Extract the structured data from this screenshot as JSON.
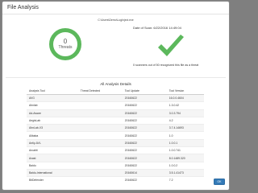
{
  "dialog": {
    "title": "File Analysis",
    "file_path": "C:\\Users\\Demo\\LogInject.exe"
  },
  "summary": {
    "threat_count": "0",
    "threat_label": "Threats",
    "scan_date": "Date of Scan: 6/22/2016 14:49:04",
    "scan_result": "0 scanners out of 50 recognized this file as a threat",
    "accent_color": "#5cb85c",
    "result_icon": "check-icon"
  },
  "details": {
    "title": "All Analysis Details",
    "columns": [
      "Analysis Tool",
      "Threat Detected",
      "Tool Update",
      "Tool Version"
    ],
    "rows": [
      {
        "tool": "AVG",
        "threat": "",
        "update": "20160622",
        "version": "16.0.0.4604"
      },
      {
        "tool": "Ahnlab",
        "threat": "",
        "update": "20160622",
        "version": "1.3.0.42"
      },
      {
        "tool": "Ad-Aware",
        "threat": "",
        "update": "20160622",
        "version": "3.0.3.794"
      },
      {
        "tool": "AegisLab",
        "threat": "",
        "update": "20160622",
        "version": "4.2"
      },
      {
        "tool": "AhnLab-V3",
        "threat": "",
        "update": "20160622",
        "version": "3.7.4.14693"
      },
      {
        "tool": "Alibaba",
        "threat": "",
        "update": "20160622",
        "version": "1.0"
      },
      {
        "tool": "Antiy-AVL",
        "threat": "",
        "update": "20160622",
        "version": "1.0.0.1"
      },
      {
        "tool": "Arcabit",
        "threat": "",
        "update": "20160622",
        "version": "1.0.0.741"
      },
      {
        "tool": "Avast",
        "threat": "",
        "update": "20160622",
        "version": "8.0.1489.320"
      },
      {
        "tool": "Baidu",
        "threat": "",
        "update": "20160622",
        "version": "1.0.0.2"
      },
      {
        "tool": "Baidu-International",
        "threat": "",
        "update": "20160614",
        "version": "3.5.1.41473"
      },
      {
        "tool": "BitDefender",
        "threat": "",
        "update": "20160622",
        "version": "7.2"
      }
    ]
  },
  "buttons": {
    "ok_label": "OK"
  }
}
